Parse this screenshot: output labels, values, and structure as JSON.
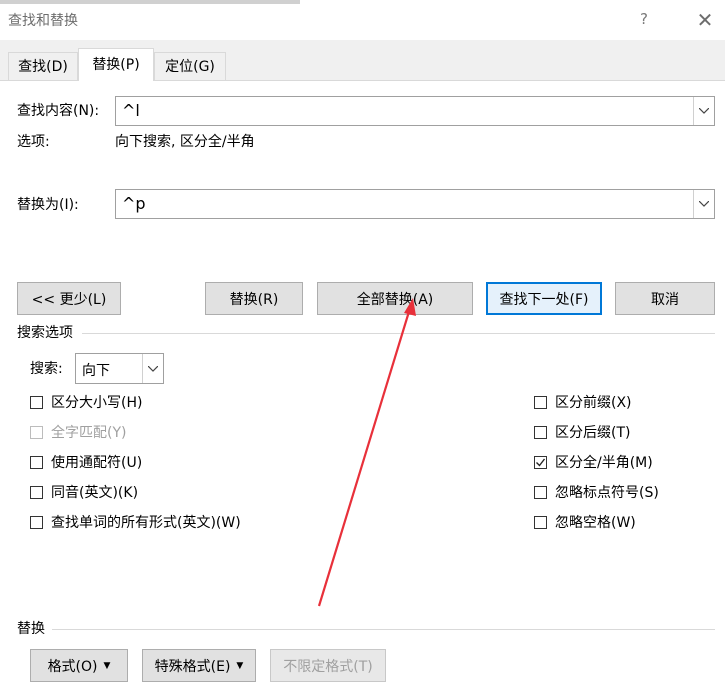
{
  "window": {
    "title": "查找和替换",
    "help": "?",
    "close": "✕"
  },
  "tabs": [
    {
      "label": "查找(D)",
      "active": false
    },
    {
      "label": "替换(P)",
      "active": true
    },
    {
      "label": "定位(G)",
      "active": false
    }
  ],
  "find": {
    "label": "查找内容(N):",
    "value": "^l"
  },
  "options": {
    "label": "选项:",
    "value": "向下搜索, 区分全/半角"
  },
  "replace": {
    "label": "替换为(I):",
    "value": "^p"
  },
  "buttons": {
    "less": "<< 更少(L)",
    "replace": "替换(R)",
    "replace_all": "全部替换(A)",
    "find_next": "查找下一处(F)",
    "cancel": "取消"
  },
  "search_options": {
    "title": "搜索选项",
    "search_label": "搜索:",
    "search_value": "向下",
    "left": [
      {
        "label": "区分大小写(H)",
        "checked": false,
        "disabled": false
      },
      {
        "label": "全字匹配(Y)",
        "checked": false,
        "disabled": true
      },
      {
        "label": "使用通配符(U)",
        "checked": false,
        "disabled": false
      },
      {
        "label": "同音(英文)(K)",
        "checked": false,
        "disabled": false
      },
      {
        "label": "查找单词的所有形式(英文)(W)",
        "checked": false,
        "disabled": false
      }
    ],
    "right": [
      {
        "label": "区分前缀(X)",
        "checked": false,
        "disabled": false
      },
      {
        "label": "区分后缀(T)",
        "checked": false,
        "disabled": false
      },
      {
        "label": "区分全/半角(M)",
        "checked": true,
        "disabled": false
      },
      {
        "label": "忽略标点符号(S)",
        "checked": false,
        "disabled": false
      },
      {
        "label": "忽略空格(W)",
        "checked": false,
        "disabled": false
      }
    ]
  },
  "replace_group": {
    "title": "替换",
    "format": "格式(O)",
    "special": "特殊格式(E)",
    "no_format": "不限定格式(T)"
  },
  "colors": {
    "accent": "#0078d7",
    "annotation_arrow": "#e8303a"
  }
}
